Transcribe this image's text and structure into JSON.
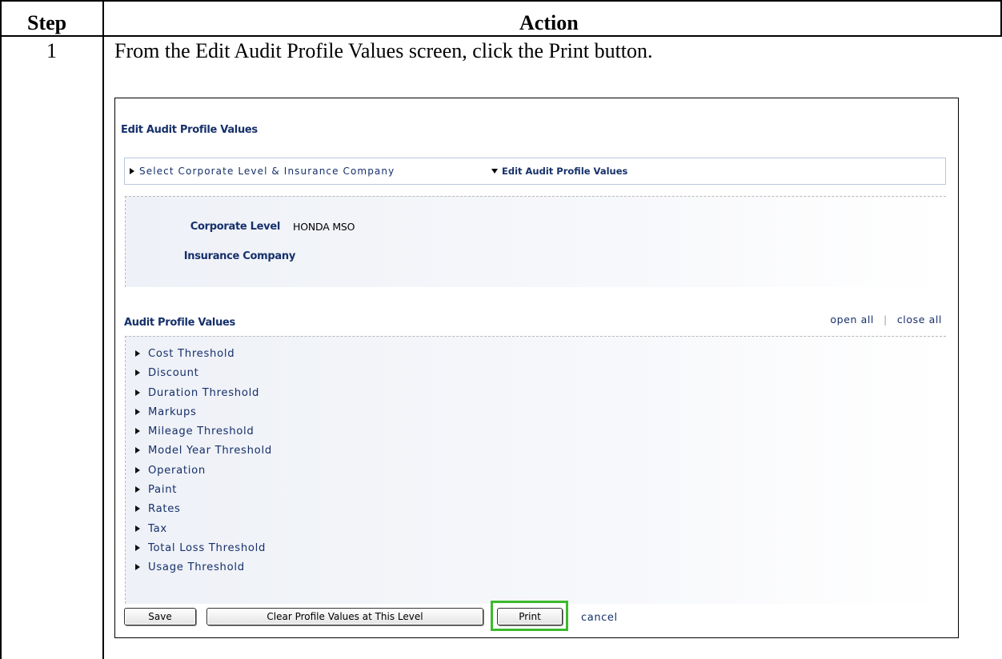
{
  "table": {
    "header_step": "Step",
    "header_action": "Action",
    "rows": [
      {
        "step": "1",
        "instruction": "From the Edit Audit Profile Values screen, click the Print button."
      }
    ]
  },
  "screenshot": {
    "title": "Edit Audit Profile Values",
    "breadcrumb": {
      "collapsed_step": "Select Corporate Level & Insurance Company",
      "active_step": "Edit Audit Profile Values"
    },
    "info": {
      "corporate_level_label": "Corporate Level",
      "corporate_level_value": "HONDA MSO",
      "insurance_company_label": "Insurance Company",
      "insurance_company_value": ""
    },
    "section_title": "Audit Profile Values",
    "open_all": "open all",
    "separator": "|",
    "close_all": "close all",
    "items": [
      "Cost Threshold",
      "Discount",
      "Duration Threshold",
      "Markups",
      "Mileage Threshold",
      "Model Year Threshold",
      "Operation",
      "Paint",
      "Rates",
      "Tax",
      "Total Loss Threshold",
      "Usage Threshold"
    ],
    "buttons": {
      "save": "Save",
      "clear": "Clear Profile Values at This Level",
      "print": "Print",
      "cancel": "cancel"
    },
    "highlight_color": "#3cba2c",
    "text_color": "#16306a"
  }
}
